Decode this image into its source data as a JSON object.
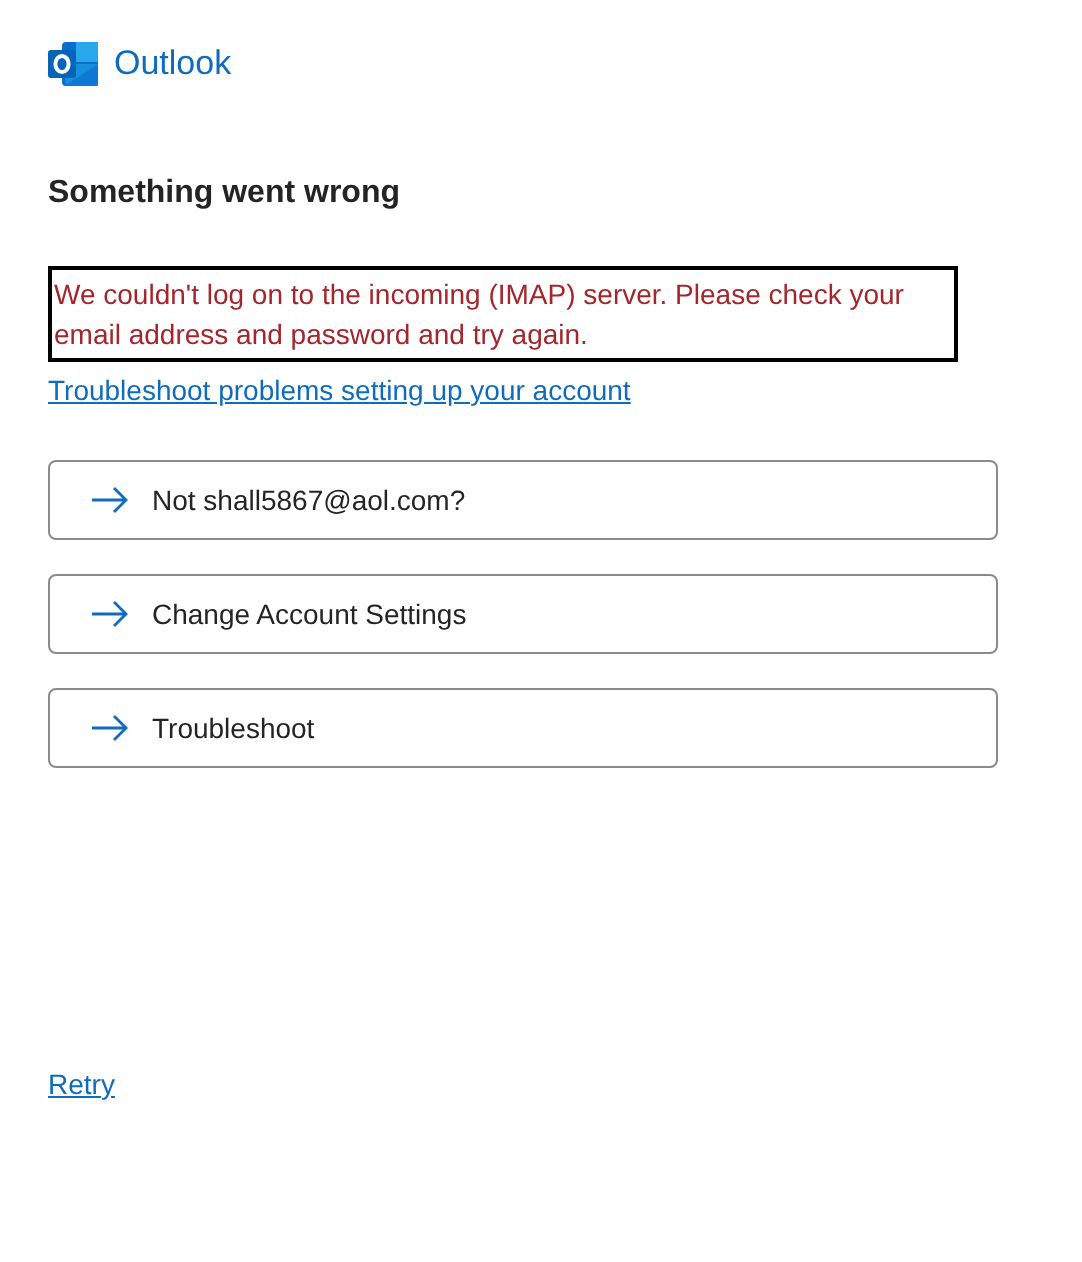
{
  "app": {
    "name": "Outlook"
  },
  "heading": "Something went wrong",
  "error": "We couldn't log on to the incoming (IMAP) server. Please check your email address and password and try again.",
  "help_link": "Troubleshoot problems setting up your account",
  "actions": [
    {
      "label": "Not shall5867@aol.com?"
    },
    {
      "label": "Change Account Settings"
    },
    {
      "label": "Troubleshoot"
    }
  ],
  "retry": "Retry"
}
